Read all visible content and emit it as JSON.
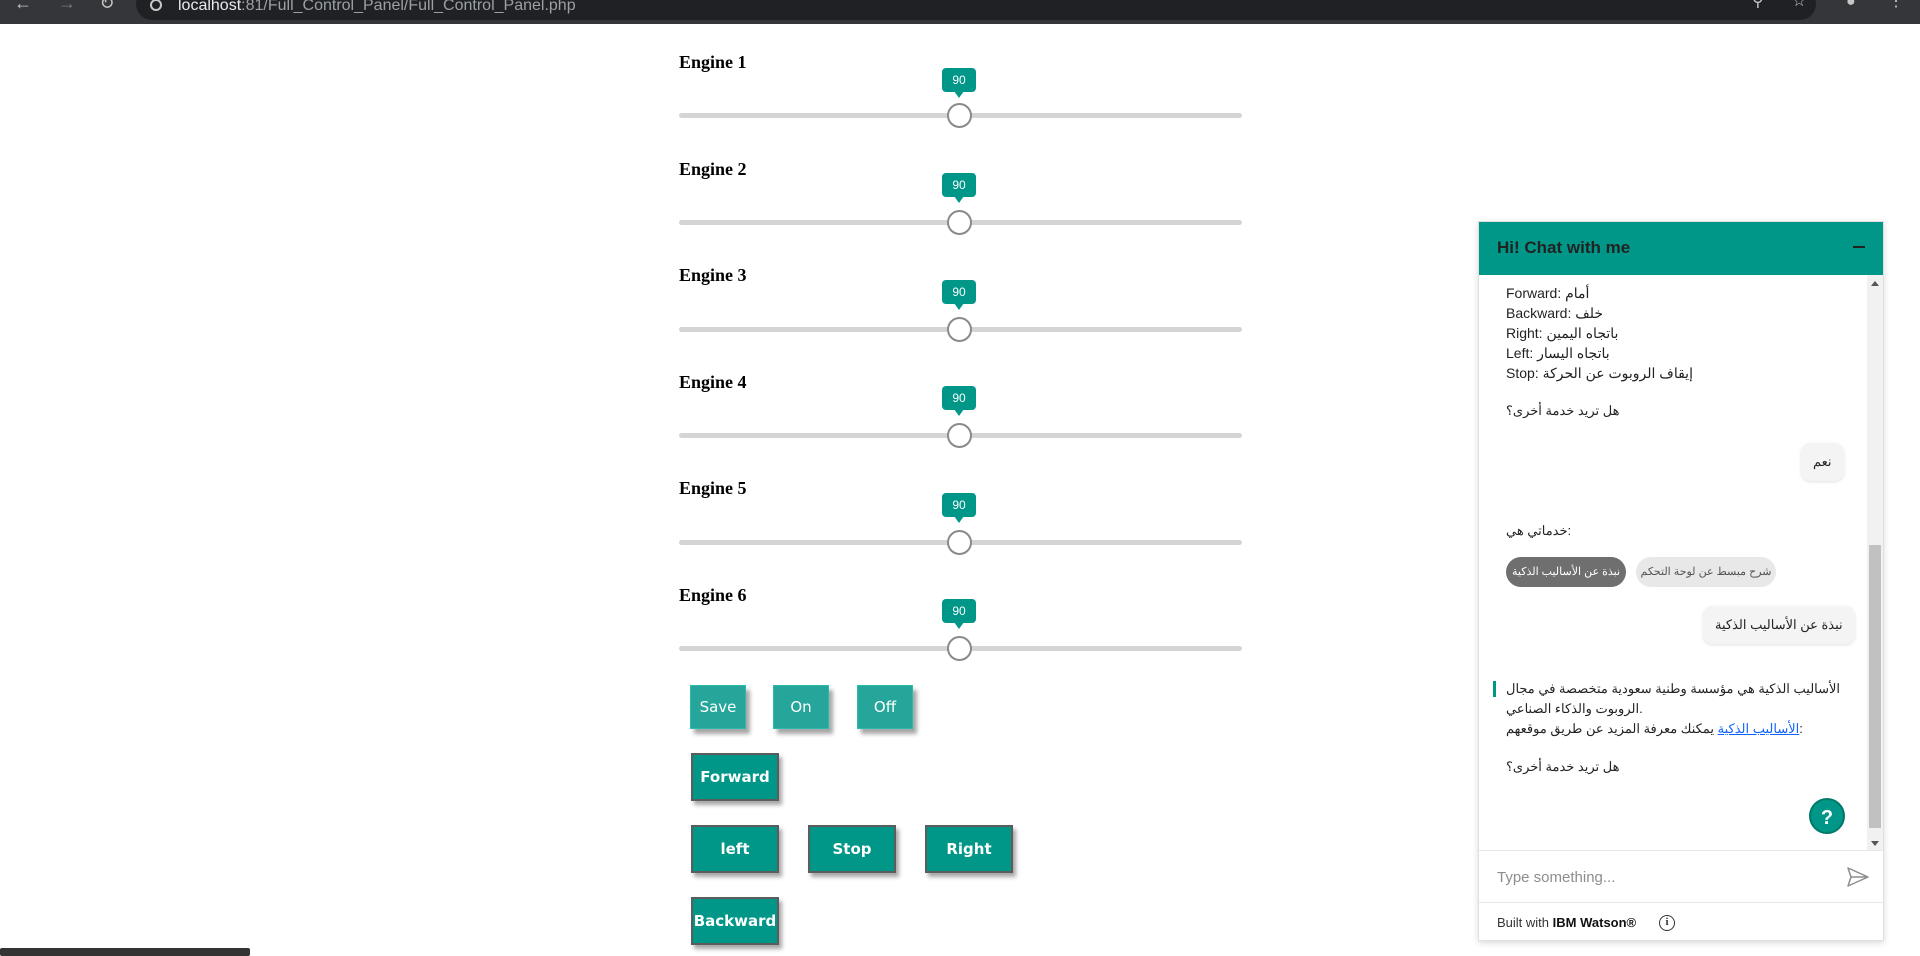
{
  "browser": {
    "url_host": "localhost",
    "url_path": ":81/Full_Control_Panel/Full_Control_Panel.php"
  },
  "engines": [
    {
      "label": "Engine 1",
      "value": "90",
      "level": 0.5
    },
    {
      "label": "Engine 2",
      "value": "90",
      "level": 0.5
    },
    {
      "label": "Engine 3",
      "value": "90",
      "level": 0.5
    },
    {
      "label": "Engine 4",
      "value": "90",
      "level": 0.5
    },
    {
      "label": "Engine 5",
      "value": "90",
      "level": 0.5
    },
    {
      "label": "Engine 6",
      "value": "90",
      "level": 0.5
    }
  ],
  "controls": {
    "save": "Save",
    "on": "On",
    "off": "Off",
    "forward": "Forward",
    "left": "left",
    "stop": "Stop",
    "right": "Right",
    "backward": "Backward"
  },
  "chat": {
    "title": "Hi! Chat with me",
    "commands": [
      "Forward: أمام",
      "Backward: خلف",
      "Right: باتجاه اليمين",
      "Left: باتجاه اليسار",
      "Stop: إيقاف الروبوت عن الحركة"
    ],
    "prompt1": "هل تريد خدمة أخرى؟",
    "user_reply1": "نعم",
    "services_title": "خدماتي هي:",
    "option_selected": "نبذة عن الأساليب الذكية",
    "option_other": "شرح مبسط عن لوحة التحكم",
    "user_reply2": "نبذة عن الأساليب الذكية",
    "about_line1": "الأساليب الذكية هي مؤسسة وطنية سعودية متخصصة في مجال",
    "about_line2": "الروبوت والذكاء الصناعي.",
    "about_line3_prefix": "يمكنك معرفة المزيد عن طريق موقعهم:",
    "about_link": "الأساليب الذكية",
    "prompt2": "هل تريد خدمة أخرى؟",
    "help": "?",
    "input_placeholder": "Type something...",
    "footer_prefix": "Built with",
    "footer_brand": "IBM Watson®",
    "info": "i"
  }
}
